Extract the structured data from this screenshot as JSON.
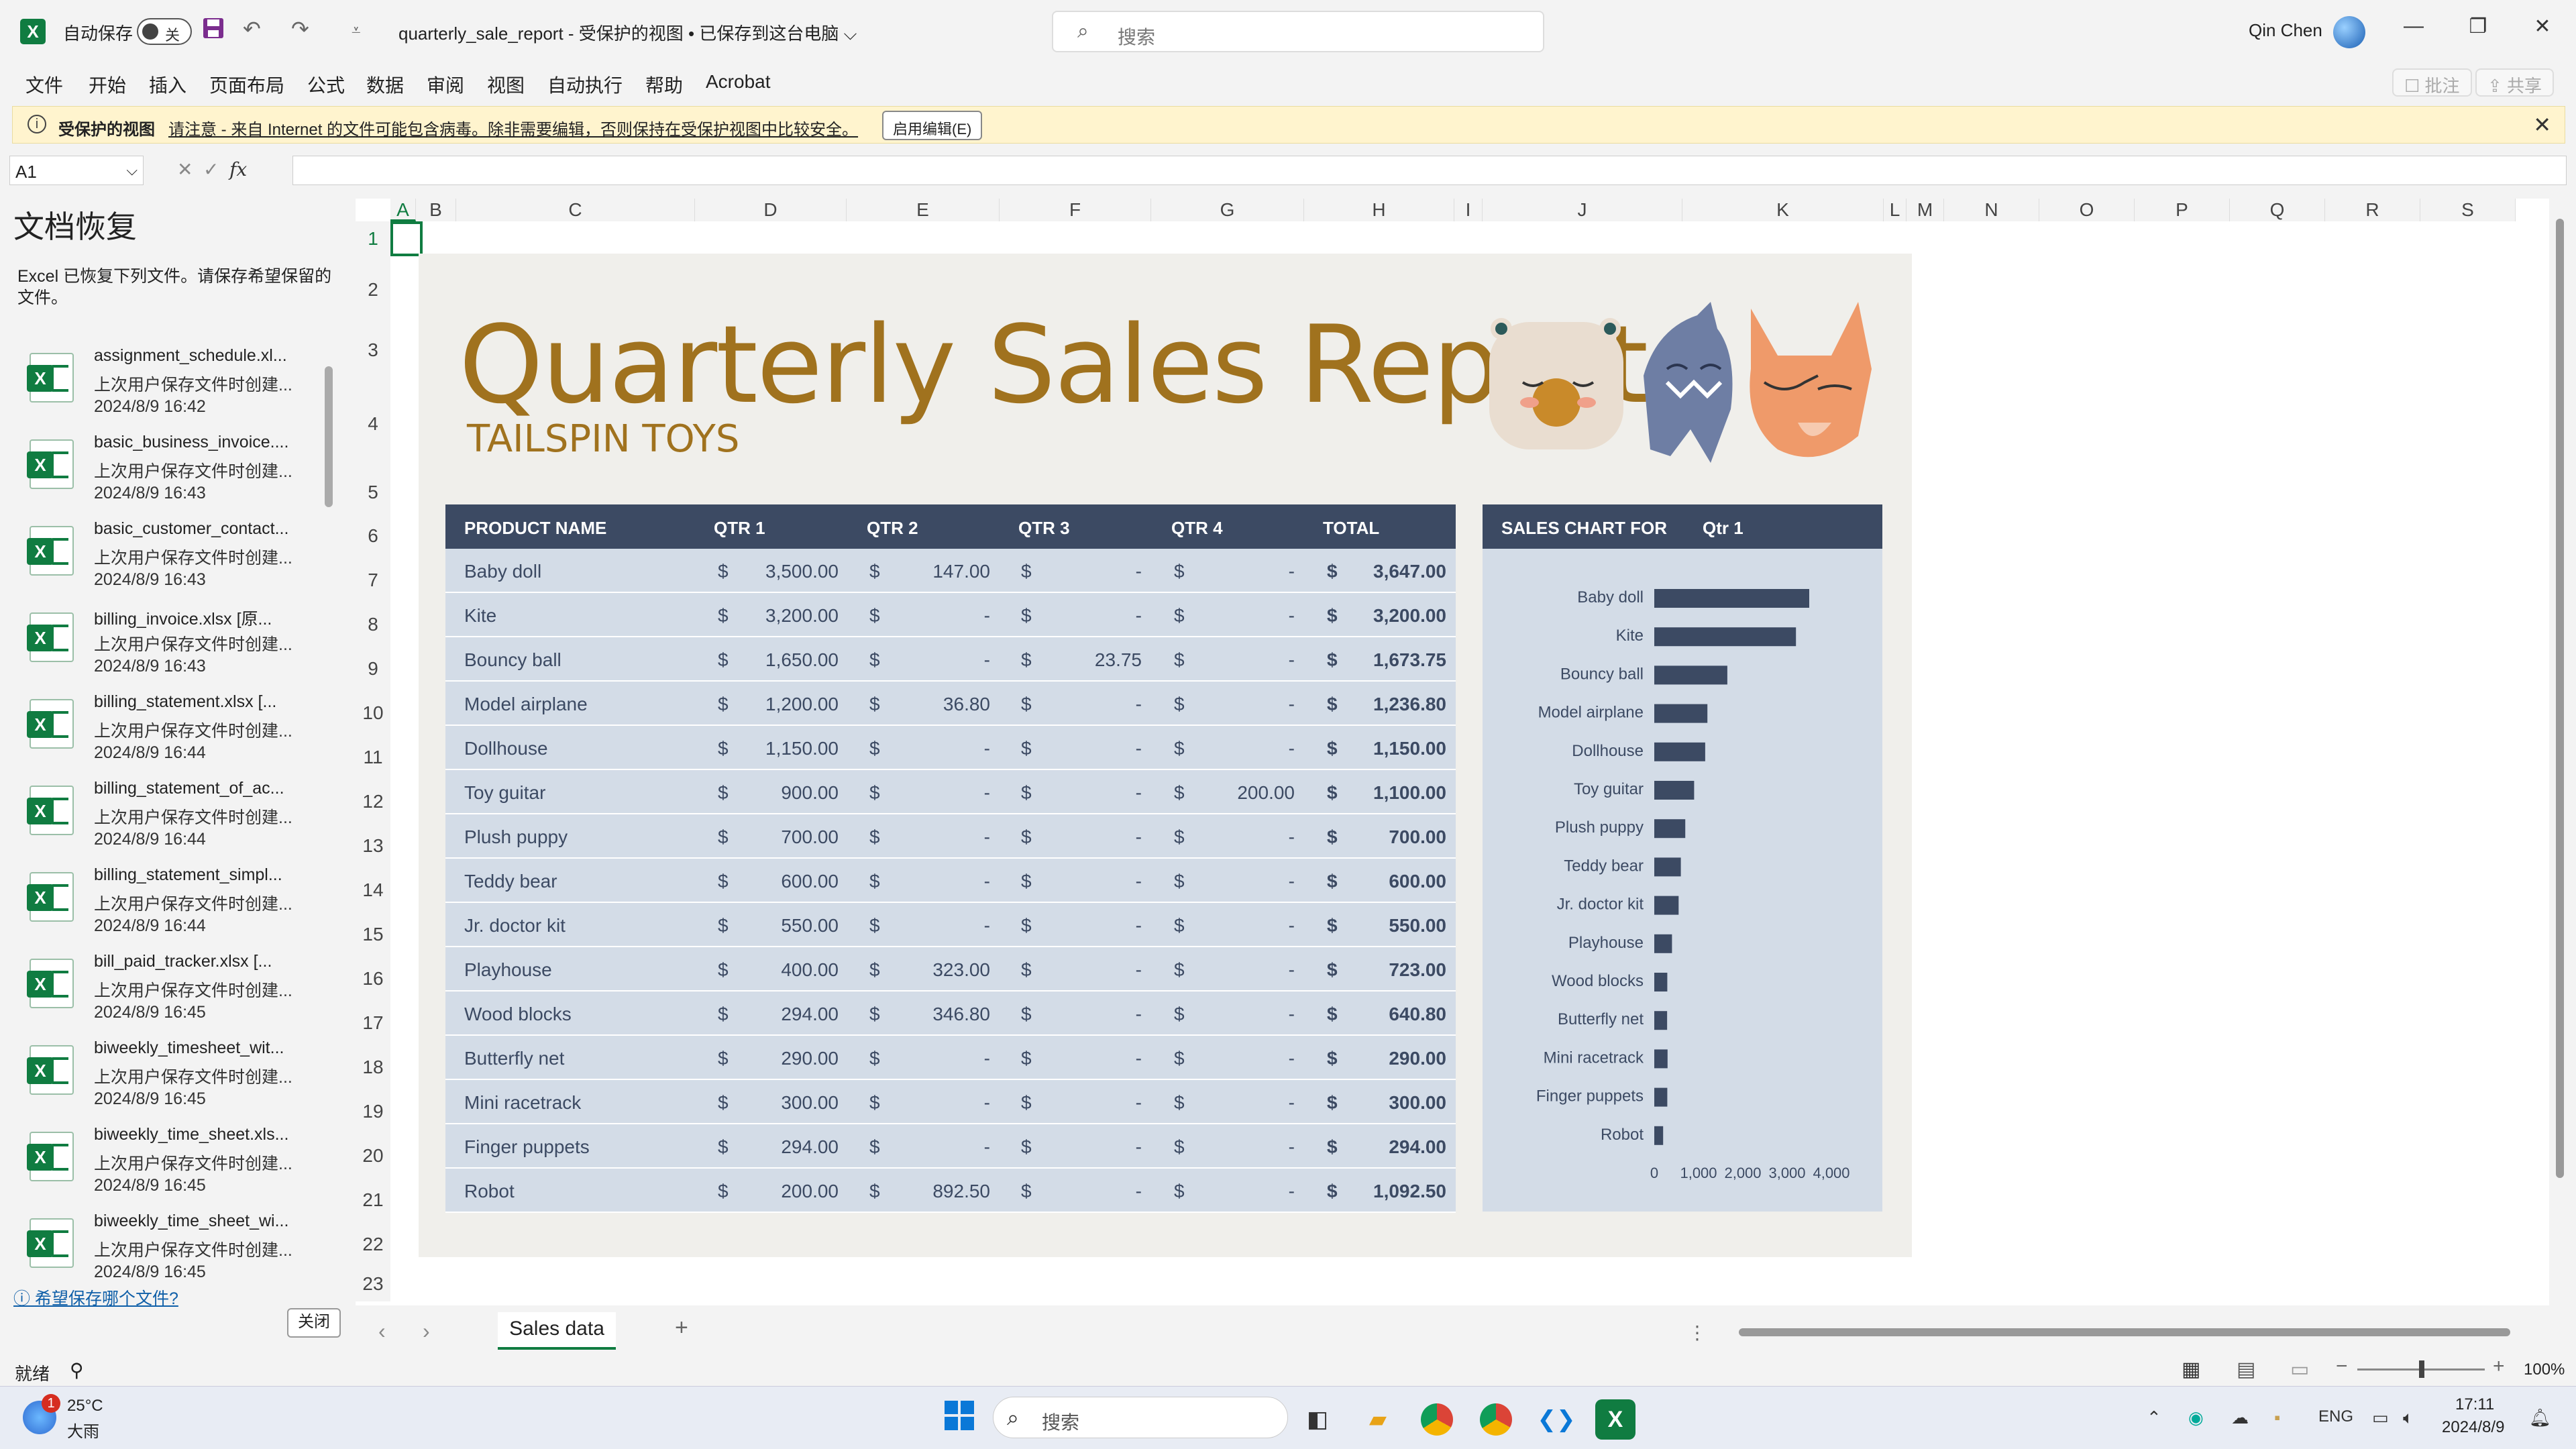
{
  "titlebar": {
    "autosave_label": "自动保存",
    "autosave_state": "关",
    "doc_title": "quarterly_sale_report  -  受保护的视图 • 已保存到这台电脑 ⌵",
    "search_placeholder": "搜索",
    "user_name": "Qin Chen",
    "app_letter": "X"
  },
  "menu": [
    "文件",
    "开始",
    "插入",
    "页面布局",
    "公式",
    "数据",
    "审阅",
    "视图",
    "自动执行",
    "帮助",
    "Acrobat"
  ],
  "ribbon_right": {
    "comment": "☐ 批注",
    "share": "⇪ 共享"
  },
  "protected_bar": {
    "title": "受保护的视图",
    "message": "请注意 - 来自 Internet 的文件可能包含病毒。除非需要编辑，否则保持在受保护视图中比较安全。",
    "enable_button": "启用编辑(E)"
  },
  "formula_bar": {
    "name_box": "A1",
    "fx": "fx",
    "content": ""
  },
  "recovery": {
    "title": "文档恢复",
    "description": "Excel 已恢复下列文件。请保存希望保留的文件。",
    "files": [
      {
        "name": "assignment_schedule.xl...",
        "status": "上次用户保存文件时创建...",
        "date": "2024/8/9 16:42"
      },
      {
        "name": "basic_business_invoice....",
        "status": "上次用户保存文件时创建...",
        "date": "2024/8/9 16:43"
      },
      {
        "name": "basic_customer_contact...",
        "status": "上次用户保存文件时创建...",
        "date": "2024/8/9 16:43"
      },
      {
        "name": "billing_invoice.xlsx  [原...",
        "status": "上次用户保存文件时创建...",
        "date": "2024/8/9 16:43"
      },
      {
        "name": "billing_statement.xlsx  [...",
        "status": "上次用户保存文件时创建...",
        "date": "2024/8/9 16:44"
      },
      {
        "name": "billing_statement_of_ac...",
        "status": "上次用户保存文件时创建...",
        "date": "2024/8/9 16:44"
      },
      {
        "name": "billing_statement_simpl...",
        "status": "上次用户保存文件时创建...",
        "date": "2024/8/9 16:44"
      },
      {
        "name": "bill_paid_tracker.xlsx  [...",
        "status": "上次用户保存文件时创建...",
        "date": "2024/8/9 16:45"
      },
      {
        "name": "biweekly_timesheet_wit...",
        "status": "上次用户保存文件时创建...",
        "date": "2024/8/9 16:45"
      },
      {
        "name": "biweekly_time_sheet.xls...",
        "status": "上次用户保存文件时创建...",
        "date": "2024/8/9 16:45"
      },
      {
        "name": "biweekly_time_sheet_wi...",
        "status": "上次用户保存文件时创建...",
        "date": "2024/8/9 16:45"
      }
    ],
    "help_link": "希望保存哪个文件?",
    "close_button": "关闭"
  },
  "grid": {
    "columns": [
      "A",
      "B",
      "C",
      "D",
      "E",
      "F",
      "G",
      "H",
      "I",
      "J",
      "K",
      "L",
      "M",
      "N",
      "O",
      "P",
      "Q",
      "R",
      "S"
    ],
    "rows": [
      "1",
      "2",
      "3",
      "4",
      "5",
      "6",
      "7",
      "8",
      "9",
      "10",
      "11",
      "12",
      "13",
      "14",
      "15",
      "16",
      "17",
      "18",
      "19",
      "20",
      "21",
      "22",
      "23"
    ]
  },
  "report": {
    "title": "Quarterly Sales Report",
    "subtitle": "TAILSPIN TOYS",
    "headers": [
      "PRODUCT NAME",
      "QTR 1",
      "QTR 2",
      "QTR 3",
      "QTR 4",
      "TOTAL"
    ],
    "currency": "$",
    "rows": [
      {
        "name": "Baby doll",
        "q1": "3,500.00",
        "q2": "147.00",
        "q3": "-",
        "q4": "-",
        "total": "3,647.00"
      },
      {
        "name": "Kite",
        "q1": "3,200.00",
        "q2": "-",
        "q3": "-",
        "q4": "-",
        "total": "3,200.00"
      },
      {
        "name": "Bouncy ball",
        "q1": "1,650.00",
        "q2": "-",
        "q3": "23.75",
        "q4": "-",
        "total": "1,673.75"
      },
      {
        "name": "Model airplane",
        "q1": "1,200.00",
        "q2": "36.80",
        "q3": "-",
        "q4": "-",
        "total": "1,236.80"
      },
      {
        "name": "Dollhouse",
        "q1": "1,150.00",
        "q2": "-",
        "q3": "-",
        "q4": "-",
        "total": "1,150.00"
      },
      {
        "name": "Toy guitar",
        "q1": "900.00",
        "q2": "-",
        "q3": "-",
        "q4": "200.00",
        "total": "1,100.00"
      },
      {
        "name": "Plush puppy",
        "q1": "700.00",
        "q2": "-",
        "q3": "-",
        "q4": "-",
        "total": "700.00"
      },
      {
        "name": "Teddy bear",
        "q1": "600.00",
        "q2": "-",
        "q3": "-",
        "q4": "-",
        "total": "600.00"
      },
      {
        "name": "Jr. doctor kit",
        "q1": "550.00",
        "q2": "-",
        "q3": "-",
        "q4": "-",
        "total": "550.00"
      },
      {
        "name": "Playhouse",
        "q1": "400.00",
        "q2": "323.00",
        "q3": "-",
        "q4": "-",
        "total": "723.00"
      },
      {
        "name": "Wood blocks",
        "q1": "294.00",
        "q2": "346.80",
        "q3": "-",
        "q4": "-",
        "total": "640.80"
      },
      {
        "name": "Butterfly net",
        "q1": "290.00",
        "q2": "-",
        "q3": "-",
        "q4": "-",
        "total": "290.00"
      },
      {
        "name": "Mini racetrack",
        "q1": "300.00",
        "q2": "-",
        "q3": "-",
        "q4": "-",
        "total": "300.00"
      },
      {
        "name": "Finger puppets",
        "q1": "294.00",
        "q2": "-",
        "q3": "-",
        "q4": "-",
        "total": "294.00"
      },
      {
        "name": "Robot",
        "q1": "200.00",
        "q2": "892.50",
        "q3": "-",
        "q4": "-",
        "total": "1,092.50"
      }
    ],
    "chart_header": "SALES CHART FOR",
    "chart_period": "Qtr 1"
  },
  "chart_data": {
    "type": "bar",
    "orientation": "horizontal",
    "categories": [
      "Baby doll",
      "Kite",
      "Bouncy ball",
      "Model airplane",
      "Dollhouse",
      "Toy guitar",
      "Plush puppy",
      "Teddy bear",
      "Jr. doctor kit",
      "Playhouse",
      "Wood blocks",
      "Butterfly net",
      "Mini racetrack",
      "Finger puppets",
      "Robot"
    ],
    "values": [
      3500,
      3200,
      1650,
      1200,
      1150,
      900,
      700,
      600,
      550,
      400,
      294,
      290,
      300,
      294,
      200
    ],
    "xlim": [
      0,
      4000
    ],
    "x_ticks": [
      "0",
      "1,000",
      "2,000",
      "3,000",
      "4,000"
    ],
    "bar_color": "#3c4a63"
  },
  "sheet": {
    "tab": "Sales data",
    "add": "+"
  },
  "status": {
    "ready": "就绪",
    "zoom": "100%"
  },
  "taskbar": {
    "temp": "25°C",
    "weather": "大雨",
    "badge": "1",
    "search_placeholder": "搜索",
    "lang": "ENG",
    "time": "17:11",
    "date": "2024/8/9"
  },
  "colors": {
    "accent": "#107c41",
    "header_navy": "#3c4a63",
    "row_blue": "#d3dce7",
    "title_gold": "#a0721e"
  }
}
